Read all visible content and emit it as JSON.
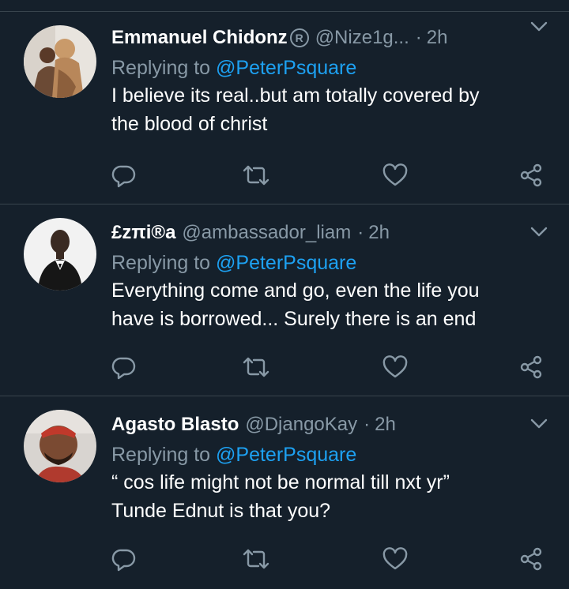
{
  "colors": {
    "background": "#15202b",
    "divider": "#38444d",
    "muted": "#8899a6",
    "accent": "#1da1f2",
    "text": "#ffffff"
  },
  "tweets": [
    {
      "name": "Emmanuel Chidonz",
      "badge": "R",
      "handle": "@Nize1g...",
      "dot": "·",
      "time": "2h",
      "replying_prefix": "Replying to ",
      "replying_to": "@PeterPsquare",
      "text_lines": [
        "I believe its real..but am totally covered by",
        "the blood of christ"
      ]
    },
    {
      "name": "£zπi®a",
      "handle": "@ambassador_liam",
      "dot": "·",
      "time": "2h",
      "replying_prefix": "Replying to ",
      "replying_to": "@PeterPsquare",
      "text_lines": [
        "Everything come and go, even the life you",
        "have is borrowed... Surely there is an end"
      ]
    },
    {
      "name": "Agasto Blasto",
      "handle": "@DjangoKay",
      "dot": "·",
      "time": "2h",
      "replying_prefix": "Replying to ",
      "replying_to": "@PeterPsquare",
      "text_lines": [
        "“ cos life might not be normal till nxt yr”",
        "Tunde Ednut is that you?"
      ]
    }
  ],
  "icons": {
    "reply": "reply-icon",
    "retweet": "retweet-icon",
    "like": "heart-icon",
    "share": "share-icon",
    "more": "chevron-down-icon"
  }
}
